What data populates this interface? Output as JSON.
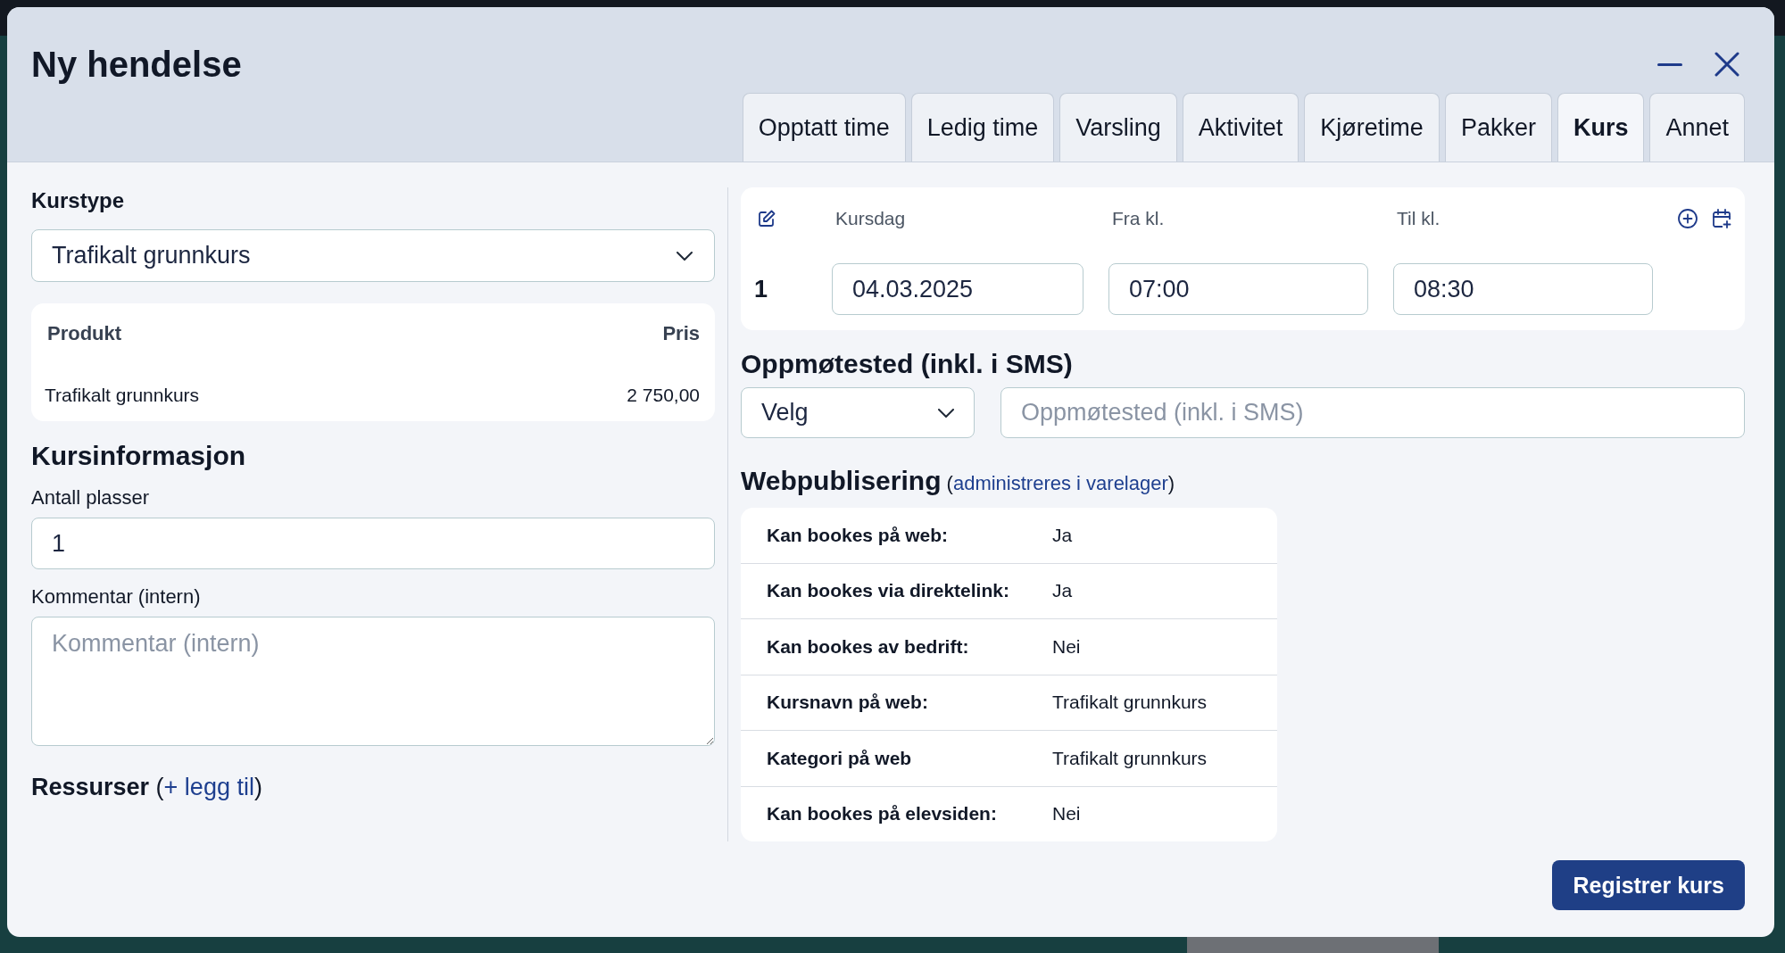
{
  "dialog": {
    "title": "Ny hendelse",
    "tabs": [
      {
        "label": "Opptatt time",
        "selected": false
      },
      {
        "label": "Ledig time",
        "selected": false
      },
      {
        "label": "Varsling",
        "selected": false
      },
      {
        "label": "Aktivitet",
        "selected": false
      },
      {
        "label": "Kjøretime",
        "selected": false
      },
      {
        "label": "Pakker",
        "selected": false
      },
      {
        "label": "Kurs",
        "selected": true
      },
      {
        "label": "Annet",
        "selected": false
      }
    ]
  },
  "course_type": {
    "label": "Kurstype",
    "value": "Trafikalt grunnkurs"
  },
  "product_table": {
    "columns": [
      "Produkt",
      "Pris"
    ],
    "rows": [
      [
        "Trafikalt grunnkurs",
        "2 750,00"
      ]
    ]
  },
  "course_info": {
    "heading": "Kursinformasjon",
    "seats": {
      "label": "Antall plasser",
      "value": "1"
    },
    "comment": {
      "label": "Kommentar (intern)",
      "placeholder": "Kommentar (intern)"
    }
  },
  "resources": {
    "heading": "Ressurser",
    "brackets": [
      "(",
      ")"
    ],
    "link": "+ legg til"
  },
  "schedule": {
    "columns": [
      "Kursdag",
      "Fra kl.",
      "Til kl."
    ],
    "rows": [
      {
        "number": "1",
        "date": "04.03.2025",
        "from": "07:00",
        "to": "08:30"
      }
    ]
  },
  "meeting_place": {
    "heading": "Oppmøtested (inkl. i SMS)",
    "select": "Velg",
    "placeholder": "Oppmøtested (inkl. i SMS)"
  },
  "web_publishing": {
    "heading": "Webpublisering",
    "brackets": [
      "(",
      ")"
    ],
    "link": "administreres i varelager",
    "rows": [
      {
        "label": "Kan bookes på web:",
        "value": "Ja"
      },
      {
        "label": "Kan bookes via direktelink:",
        "value": "Ja"
      },
      {
        "label": "Kan bookes av bedrift:",
        "value": "Nei"
      },
      {
        "label": "Kursnavn på web:",
        "value": "Trafikalt grunnkurs"
      },
      {
        "label": "Kategori på web",
        "value": "Trafikalt grunnkurs"
      },
      {
        "label": "Kan bookes på elevsiden:",
        "value": "Nei"
      }
    ]
  },
  "submit_button": "Registrer kurs"
}
